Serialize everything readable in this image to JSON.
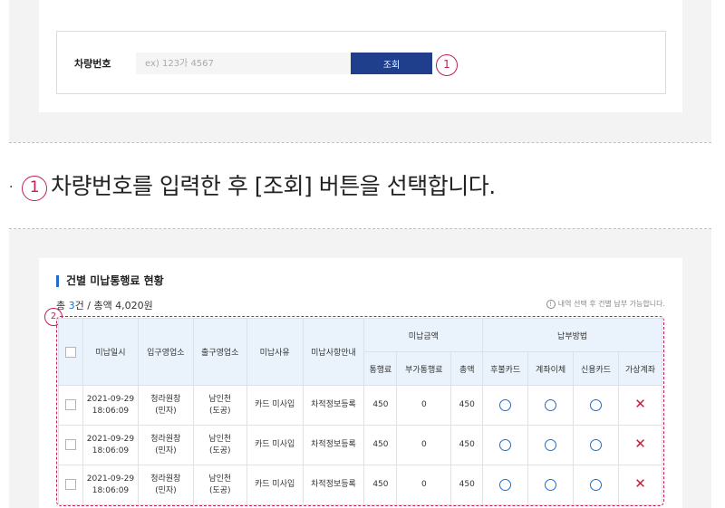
{
  "search": {
    "label": "차량번호",
    "placeholder": "ex) 123가 4567",
    "button_label": "조회",
    "marker": "1"
  },
  "instruction": {
    "bullet": "·",
    "marker": "1",
    "text": "차량번호를 입력한 후 [조회] 버튼을 선택합니다."
  },
  "section": {
    "title": "건별 미납통행료 현황",
    "summary_prefix": "총 ",
    "summary_count": "3",
    "summary_rest": "건 / 총액 4,020원",
    "notice_icon": "!",
    "notice": "내역 선택 후 건별 납부 가능합니다.",
    "marker": "2"
  },
  "table": {
    "headers": {
      "date": "미납일시",
      "entry": "입구영업소",
      "exit": "출구영업소",
      "reason": "미납사유",
      "guide": "미납사항안내",
      "amount_group": "미납금액",
      "payment_group": "납부방법",
      "toll": "통행료",
      "extra": "부가통행료",
      "total": "총액",
      "postpaid": "후불카드",
      "transfer": "계좌이체",
      "credit": "신용카드",
      "virtual": "가상계좌"
    },
    "rows": [
      {
        "date": "2021-09-29",
        "time": "18:06:09",
        "entry": "청라원창",
        "entry_type": "(민자)",
        "exit": "남인천",
        "exit_type": "(도공)",
        "reason": "카드 미사입",
        "guide": "차적정보등록",
        "toll": "450",
        "extra": "0",
        "total": "450",
        "postpaid": "available",
        "transfer": "available",
        "credit": "available",
        "virtual": "unavailable"
      },
      {
        "date": "2021-09-29",
        "time": "18:06:09",
        "entry": "청라원창",
        "entry_type": "(민자)",
        "exit": "남인천",
        "exit_type": "(도공)",
        "reason": "카드 미사입",
        "guide": "차적정보등록",
        "toll": "450",
        "extra": "0",
        "total": "450",
        "postpaid": "available",
        "transfer": "available",
        "credit": "available",
        "virtual": "unavailable"
      },
      {
        "date": "2021-09-29",
        "time": "18:06:09",
        "entry": "청라원창",
        "entry_type": "(민자)",
        "exit": "남인천",
        "exit_type": "(도공)",
        "reason": "카드 미사입",
        "guide": "차적정보등록",
        "toll": "450",
        "extra": "0",
        "total": "450",
        "postpaid": "available",
        "transfer": "available",
        "credit": "available",
        "virtual": "unavailable"
      }
    ],
    "available_icon": "circle-o-icon",
    "unavailable_glyph": "✕"
  },
  "colors": {
    "brand_navy": "#1f3e8c",
    "accent_blue": "#1f6fc9",
    "marker_red": "#c41e5a",
    "header_bg": "#eaf3fb"
  }
}
